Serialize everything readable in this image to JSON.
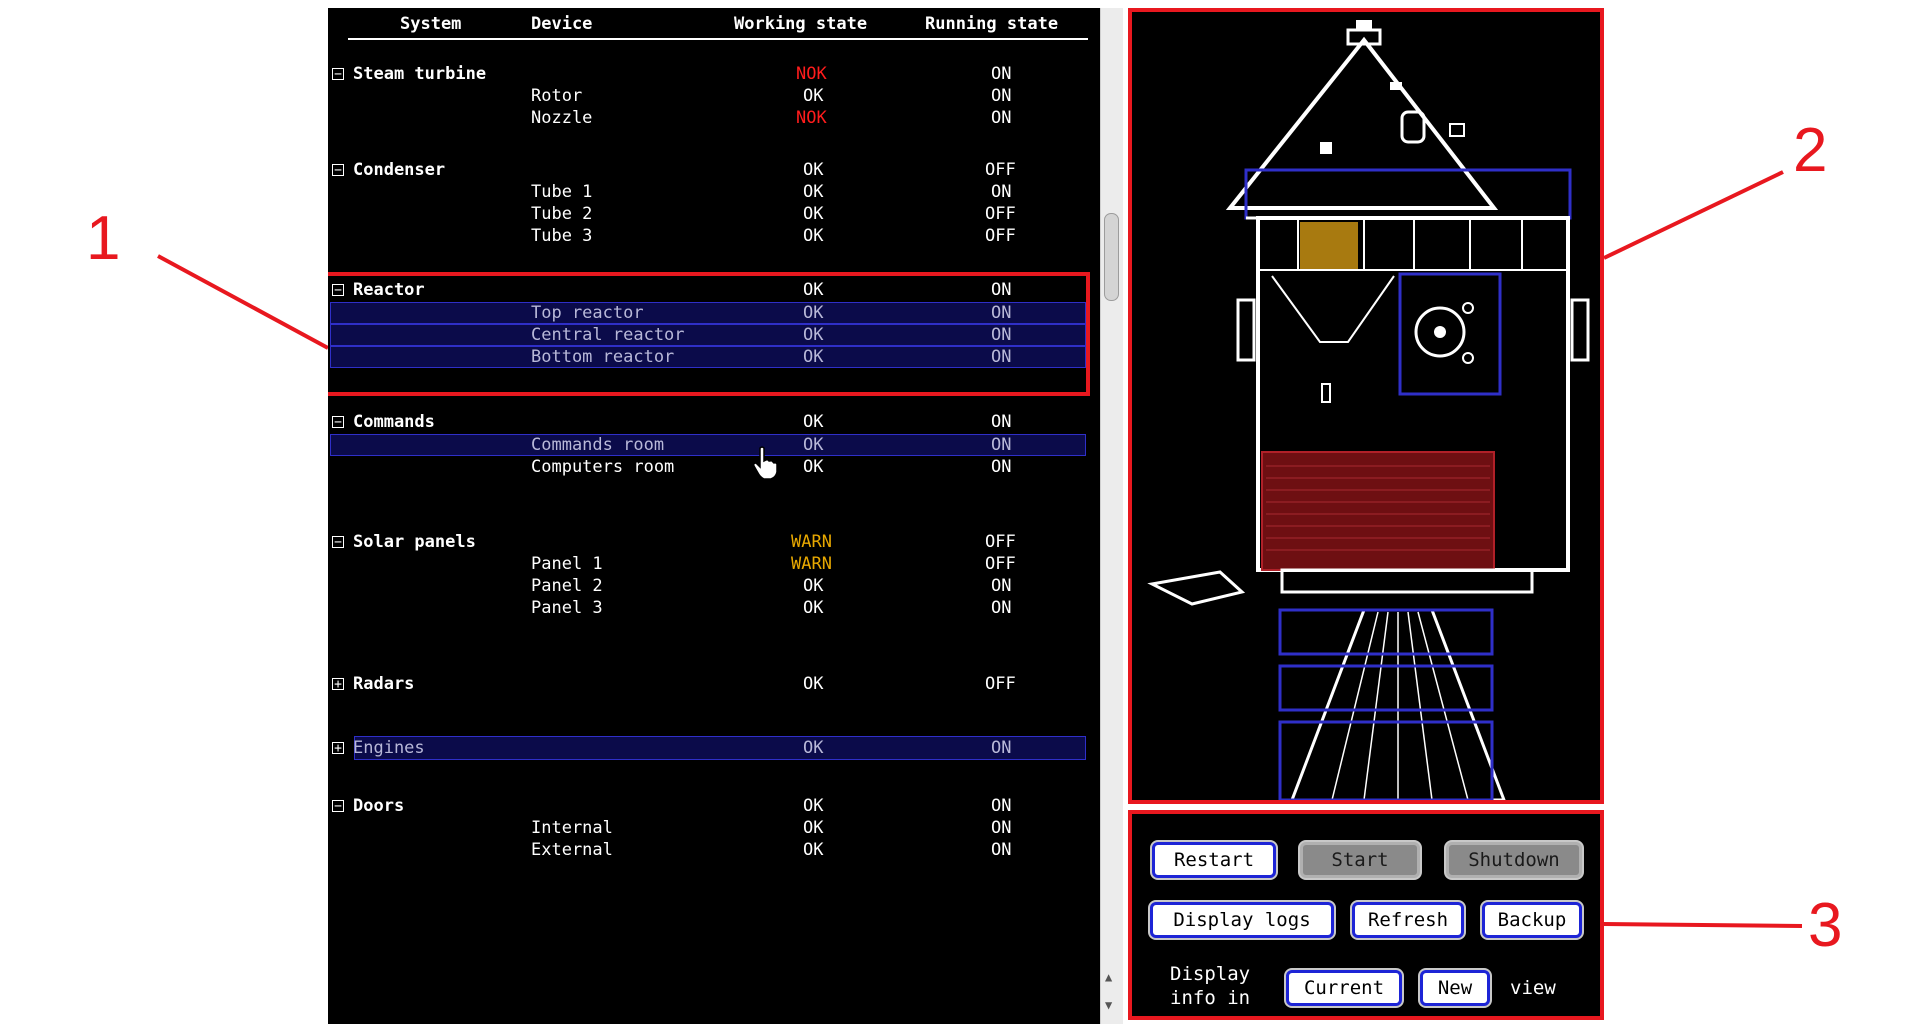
{
  "callouts": [
    "1",
    "2",
    "3"
  ],
  "table": {
    "headers": {
      "system": "System",
      "device": "Device",
      "working": "Working state",
      "running": "Running state"
    },
    "groups": [
      {
        "system": "Steam turbine",
        "expanded": true,
        "working": "NOK",
        "running": "ON",
        "devices": [
          {
            "name": "Rotor",
            "working": "OK",
            "running": "ON"
          },
          {
            "name": "Nozzle",
            "working": "NOK",
            "running": "ON"
          }
        ]
      },
      {
        "system": "Condenser",
        "expanded": true,
        "working": "OK",
        "running": "OFF",
        "devices": [
          {
            "name": "Tube 1",
            "working": "OK",
            "running": "ON"
          },
          {
            "name": "Tube 2",
            "working": "OK",
            "running": "OFF"
          },
          {
            "name": "Tube 3",
            "working": "OK",
            "running": "OFF"
          }
        ]
      },
      {
        "system": "Reactor",
        "expanded": true,
        "working": "OK",
        "running": "ON",
        "devices": [
          {
            "name": "Top reactor",
            "working": "OK",
            "running": "ON"
          },
          {
            "name": "Central reactor",
            "working": "OK",
            "running": "ON"
          },
          {
            "name": "Bottom reactor",
            "working": "OK",
            "running": "ON"
          }
        ]
      },
      {
        "system": "Commands",
        "expanded": true,
        "working": "OK",
        "running": "ON",
        "devices": [
          {
            "name": "Commands room",
            "working": "OK",
            "running": "ON"
          },
          {
            "name": "Computers room",
            "working": "OK",
            "running": "ON"
          }
        ]
      },
      {
        "system": "Solar panels",
        "expanded": true,
        "working": "WARN",
        "running": "OFF",
        "devices": [
          {
            "name": "Panel 1",
            "working": "WARN",
            "running": "OFF"
          },
          {
            "name": "Panel 2",
            "working": "OK",
            "running": "ON"
          },
          {
            "name": "Panel 3",
            "working": "OK",
            "running": "ON"
          }
        ]
      },
      {
        "system": "Radars",
        "expanded": false,
        "working": "OK",
        "running": "OFF",
        "devices": []
      },
      {
        "system": "Engines",
        "expanded": false,
        "working": "OK",
        "running": "ON",
        "devices": []
      },
      {
        "system": "Doors",
        "expanded": true,
        "working": "OK",
        "running": "ON",
        "devices": [
          {
            "name": "Internal",
            "working": "OK",
            "running": "ON"
          },
          {
            "name": "External",
            "working": "OK",
            "running": "ON"
          }
        ]
      }
    ],
    "toggle_expanded": "−",
    "toggle_collapsed": "+"
  },
  "controls": {
    "restart": "Restart",
    "start": "Start",
    "shutdown": "Shutdown",
    "display_logs": "Display logs",
    "refresh": "Refresh",
    "backup": "Backup",
    "display_info_in": "Display\ninfo in",
    "current": "Current",
    "new": "New",
    "view": "view"
  },
  "colors": {
    "callout_red": "#e8181f",
    "nok": "#ff1c1c",
    "warn": "#e8a800",
    "highlight_blue": "#2f2fc8"
  },
  "icons": {
    "expanded": "minus-box-icon",
    "collapsed": "plus-box-icon",
    "cursor": "hand-pointer-icon"
  }
}
